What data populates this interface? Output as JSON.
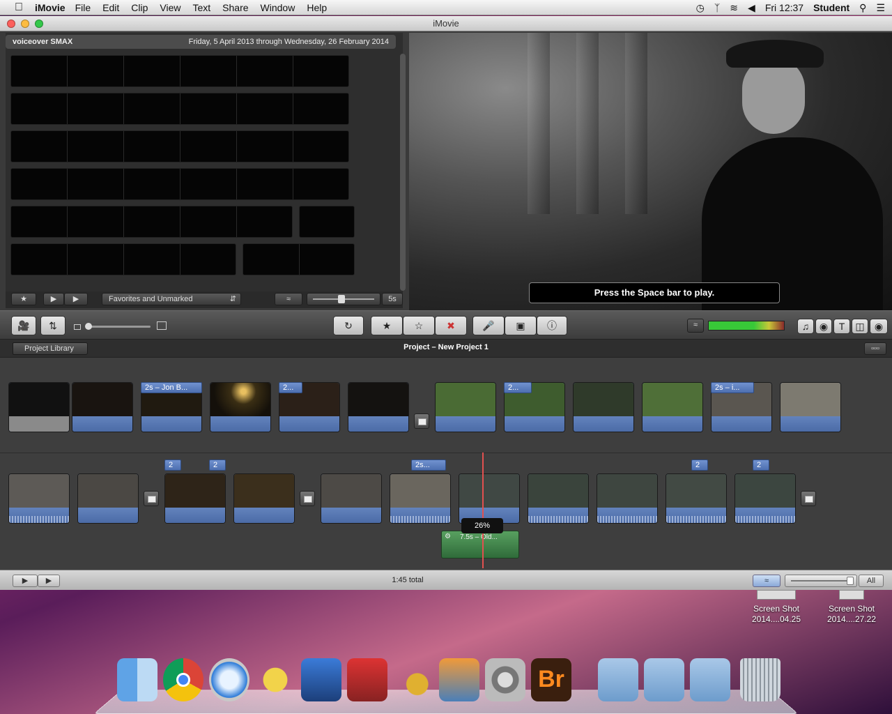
{
  "menubar": {
    "app": "iMovie",
    "items": [
      "File",
      "Edit",
      "Clip",
      "View",
      "Text",
      "Share",
      "Window",
      "Help"
    ],
    "clock": "Fri 12:37",
    "user": "Student"
  },
  "window": {
    "title": "iMovie"
  },
  "event": {
    "name": "voiceover SMAX",
    "date_range": "Friday, 5 April 2013 through Wednesday, 26 February 2014",
    "filter": "Favorites and Unmarked",
    "duration": "5s"
  },
  "viewer": {
    "hint": "Press the Space bar to play."
  },
  "project": {
    "library_button": "Project Library",
    "title": "Project – New Project 1",
    "total": "1:45 total",
    "zoom_all": "All",
    "row1_flags": [
      "2s – Jon B...",
      "2...",
      "2...",
      "2s – i..."
    ],
    "row2_flags": [
      "2",
      "2",
      "2s...",
      "2",
      "2"
    ],
    "playhead_percent": "26%",
    "voiceover_label": "7.5s – Old..."
  },
  "desktop": {
    "icons": [
      {
        "line1": "Screen Shot",
        "line2": "2014....04.25"
      },
      {
        "line1": "Screen Shot",
        "line2": "2014....27.22"
      }
    ]
  },
  "dock": {
    "items": [
      "Finder",
      "Chrome",
      "Safari",
      "iMovie",
      "Final Cut",
      "Photo Booth",
      "Cocktail",
      "iPhoto",
      "System Preferences",
      "Bridge",
      "Movies",
      "Downloads",
      "Applications",
      "Trash"
    ],
    "bridge_label": "Br"
  }
}
